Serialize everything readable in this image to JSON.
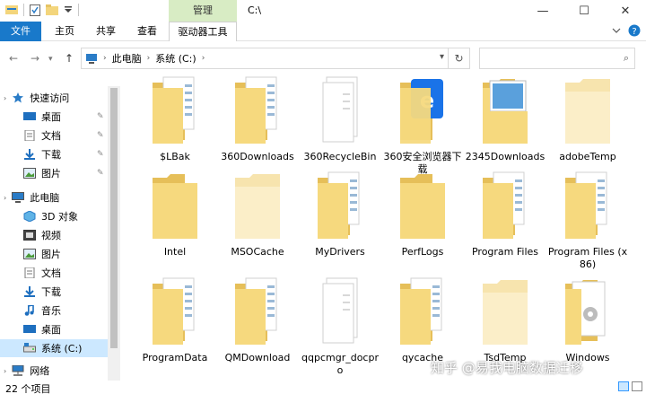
{
  "window": {
    "title": "C:\\",
    "manage_tab": "管理",
    "minimize": "—",
    "maximize": "☐",
    "close": "✕"
  },
  "ribbon": {
    "file": "文件",
    "home": "主页",
    "share": "共享",
    "view": "查看",
    "drive_tools": "驱动器工具"
  },
  "address": {
    "crumbs": [
      "此电脑",
      "系统 (C:)"
    ],
    "search_placeholder": ""
  },
  "sidebar": {
    "items": [
      {
        "label": "快速访问",
        "icon": "star-icon"
      },
      {
        "label": "桌面",
        "icon": "desktop-icon"
      },
      {
        "label": "文档",
        "icon": "documents-icon"
      },
      {
        "label": "下载",
        "icon": "download-icon"
      },
      {
        "label": "图片",
        "icon": "pictures-icon"
      },
      {
        "label": "此电脑",
        "icon": "computer-icon"
      },
      {
        "label": "3D 对象",
        "icon": "cube-icon"
      },
      {
        "label": "视频",
        "icon": "video-icon"
      },
      {
        "label": "图片",
        "icon": "pictures-icon"
      },
      {
        "label": "文档",
        "icon": "documents-icon"
      },
      {
        "label": "下载",
        "icon": "download-icon"
      },
      {
        "label": "音乐",
        "icon": "music-icon"
      },
      {
        "label": "桌面",
        "icon": "desktop-icon"
      },
      {
        "label": "系统 (C:)",
        "icon": "drive-icon"
      },
      {
        "label": "网络",
        "icon": "network-icon"
      }
    ]
  },
  "files": [
    {
      "name": "$LBak",
      "type": "folder-docs"
    },
    {
      "name": "360Downloads",
      "type": "folder-docs"
    },
    {
      "name": "360RecycleBin",
      "type": "folder-blank"
    },
    {
      "name": "360安全浏览器下载",
      "type": "folder-app"
    },
    {
      "name": "2345Downloads",
      "type": "folder-screen"
    },
    {
      "name": "adobeTemp",
      "type": "folder-light"
    },
    {
      "name": "Intel",
      "type": "folder-plain"
    },
    {
      "name": "MSOCache",
      "type": "folder-light"
    },
    {
      "name": "MyDrivers",
      "type": "folder-docs"
    },
    {
      "name": "PerfLogs",
      "type": "folder-plain"
    },
    {
      "name": "Program Files",
      "type": "folder-docs"
    },
    {
      "name": "Program Files (x86)",
      "type": "folder-docs"
    },
    {
      "name": "ProgramData",
      "type": "folder-docs"
    },
    {
      "name": "QMDownload",
      "type": "folder-docs"
    },
    {
      "name": "qqpcmgr_docpro",
      "type": "folder-blank"
    },
    {
      "name": "qycache",
      "type": "folder-docs"
    },
    {
      "name": "TsdTemp",
      "type": "folder-light"
    },
    {
      "name": "Windows",
      "type": "folder-gear"
    }
  ],
  "status": {
    "count": "22 个项目"
  },
  "watermark": "知乎 @易我电脑数据迁移",
  "colors": {
    "accent": "#1979ca",
    "folder": "#f3d57c",
    "selected": "#cce8ff",
    "manage": "#d8ecc4"
  }
}
